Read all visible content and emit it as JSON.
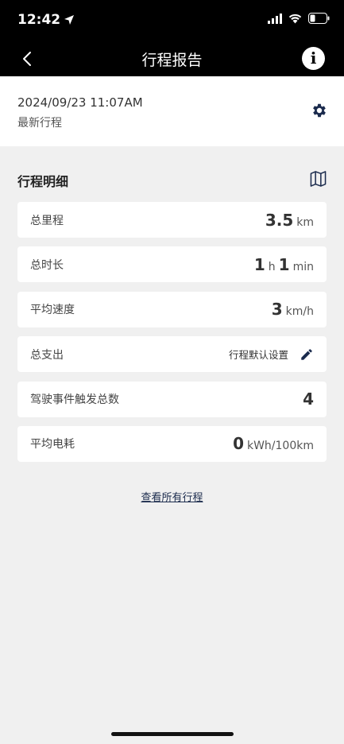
{
  "status_bar": {
    "time": "12:42",
    "location_icon": "location-arrow-icon",
    "signal_icon": "signal-icon",
    "wifi_icon": "wifi-icon",
    "battery_icon": "battery-icon"
  },
  "nav": {
    "title": "行程报告",
    "back_icon": "chevron-left-icon",
    "info_icon": "info-icon",
    "info_glyph": "i"
  },
  "header": {
    "datetime": "2024/09/23 11:07AM",
    "subtitle": "最新行程",
    "settings_icon": "gear-icon"
  },
  "details": {
    "title": "行程明细",
    "map_icon": "map-icon",
    "rows": [
      {
        "label": "总里程",
        "value": "3.5",
        "unit": "km"
      },
      {
        "label": "总时长",
        "hours": "1",
        "hours_unit": "h",
        "minutes": "1",
        "minutes_unit": "min"
      },
      {
        "label": "平均速度",
        "value": "3",
        "unit": "km/h"
      },
      {
        "label": "总支出",
        "action_label": "行程默认设置",
        "action_icon": "pencil-icon"
      },
      {
        "label": "驾驶事件触发总数",
        "value": "4"
      },
      {
        "label": "平均电耗",
        "value": "0",
        "unit": "kWh/100km"
      }
    ]
  },
  "footer": {
    "view_all_link": "查看所有行程"
  },
  "colors": {
    "top_bar": "#000000",
    "background": "#f0f0f0",
    "card": "#ffffff",
    "accent": "#1b2b4d"
  }
}
